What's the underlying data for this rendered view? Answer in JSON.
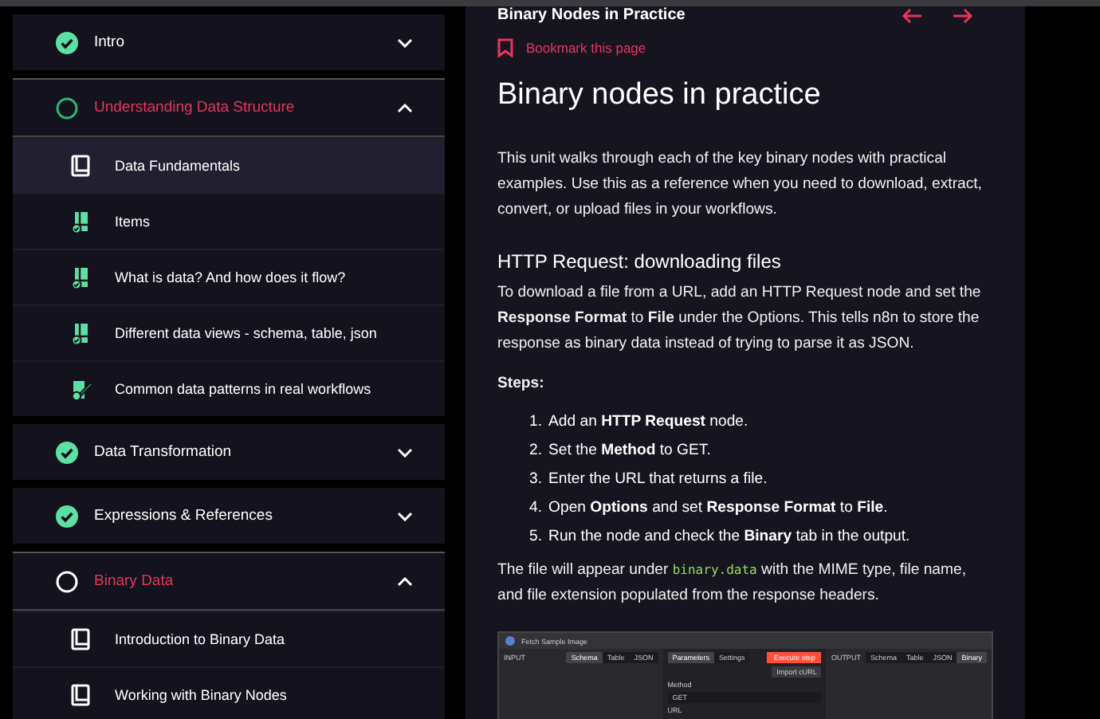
{
  "sidebar": {
    "sections": [
      {
        "title": "Intro",
        "completed": true,
        "expanded": false,
        "selected": false
      },
      {
        "title": "Understanding Data Structure",
        "completed": false,
        "started": true,
        "expanded": true,
        "selected": true,
        "lessons": [
          {
            "title": "Data Fundamentals",
            "kind": "reading",
            "selected": true
          },
          {
            "title": "Items",
            "kind": "quiz",
            "selected": false
          },
          {
            "title": "What is data? And how does it flow?",
            "kind": "quiz",
            "selected": false
          },
          {
            "title": "Different data views - schema, table, json",
            "kind": "quiz",
            "selected": false
          },
          {
            "title": "Common data patterns in real workflows",
            "kind": "exercise",
            "selected": false
          }
        ]
      },
      {
        "title": "Data Transformation",
        "completed": true,
        "expanded": false,
        "selected": false
      },
      {
        "title": "Expressions & References",
        "completed": true,
        "expanded": false,
        "selected": false
      },
      {
        "title": "Binary Data",
        "completed": false,
        "started": false,
        "expanded": true,
        "selected": true,
        "lessons": [
          {
            "title": "Introduction to Binary Data",
            "kind": "reading",
            "selected": false
          },
          {
            "title": "Working with Binary Nodes",
            "kind": "reading",
            "selected": false
          }
        ]
      }
    ]
  },
  "content": {
    "page_title": "Binary Nodes in Practice",
    "bookmark": "Bookmark this page",
    "heading": "Binary nodes in practice",
    "intro": "This unit walks through each of the key binary nodes with practical examples. Use this as a reference when you need to download, extract, convert, or upload files in your workflows.",
    "subheading": "HTTP Request: downloading files",
    "paragraph": "To download a file from a URL, add an HTTP Request node and set the **Response Format** to **File** under the Options. This tells n8n to store the response as binary data instead of trying to parse it as JSON.",
    "steps_label": "Steps:",
    "steps": [
      {
        "number": "1.",
        "text": "Add an **HTTP Request** node."
      },
      {
        "number": "2.",
        "text": "Set the **Method** to GET."
      },
      {
        "number": "3.",
        "text": "Enter the URL that returns a file."
      },
      {
        "number": "4.",
        "text": "Open **Options** and set **Response Format** to **File**."
      },
      {
        "number": "5.",
        "text": "Run the node and check the **Binary** tab in the output."
      }
    ],
    "outro_before": "The file will appear under",
    "outro_code": "binary.data",
    "outro_after": "with the MIME type, file name, and file extension populated from the response headers.",
    "screenshot": {
      "title": "Fetch Sample Image",
      "input_label": "INPUT",
      "input_tabs": [
        {
          "label": "Schema",
          "selected": true
        },
        {
          "label": "Table",
          "selected": false
        },
        {
          "label": "JSON",
          "selected": false
        }
      ],
      "mid_tabs": [
        {
          "label": "Parameters",
          "selected": true
        },
        {
          "label": "Settings",
          "selected": false
        }
      ],
      "execute": "Execute step",
      "import": "Import cURL",
      "method_label": "Method",
      "method_value": "GET",
      "url_label": "URL",
      "output_label": "OUTPUT",
      "output_tabs": [
        {
          "label": "Schema",
          "selected": false
        },
        {
          "label": "Table",
          "selected": false
        },
        {
          "label": "JSON",
          "selected": false
        },
        {
          "label": "Binary",
          "selected": true
        }
      ]
    }
  }
}
